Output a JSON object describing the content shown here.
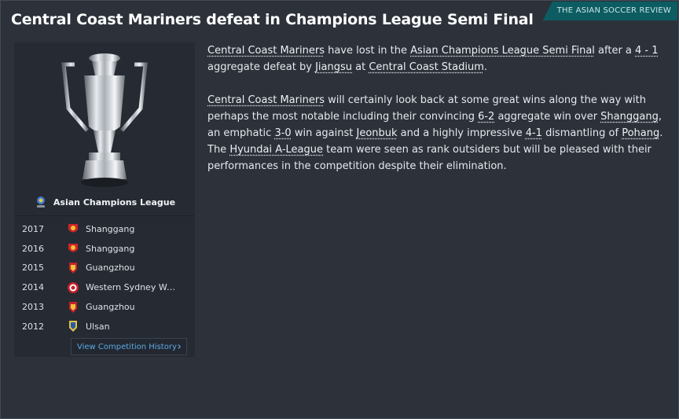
{
  "headline": "Central Coast Mariners defeat in Champions League Semi Final",
  "source": "THE ASIAN SOCCER REVIEW",
  "competition": {
    "name": "Asian Champions League",
    "history": [
      {
        "year": "2017",
        "team": "Shanggang"
      },
      {
        "year": "2016",
        "team": "Shanggang"
      },
      {
        "year": "2015",
        "team": "Guangzhou"
      },
      {
        "year": "2014",
        "team": "Western Sydney Wa..."
      },
      {
        "year": "2013",
        "team": "Guangzhou"
      },
      {
        "year": "2012",
        "team": "Ulsan"
      }
    ],
    "history_button": "View Competition History"
  },
  "article": {
    "p1": {
      "team": "Central Coast Mariners",
      "t1": " have lost in the ",
      "competition": "Asian Champions League Semi Final",
      "t2": " after a ",
      "score": "4 - 1",
      "t3": " aggregate defeat by ",
      "opponent": "Jiangsu",
      "t4": " at ",
      "stadium": "Central Coast Stadium",
      "t5": "."
    },
    "p2": {
      "team": "Central Coast Mariners",
      "t1": " will certainly look back at some great wins along the way with perhaps the most notable including their convincing ",
      "score1": "6-2",
      "t2": " aggregate win over ",
      "opp1": "Shanggang",
      "t3": ", an emphatic ",
      "score2": "3-0",
      "t4": " win against ",
      "opp2": "Jeonbuk",
      "t5": " and a highly impressive ",
      "score3": "4-1",
      "t6": " dismantling of ",
      "opp3": "Pohang",
      "t7": ". The ",
      "league": "Hyundai A-League",
      "t8": " team were seen as rank outsiders but will be pleased with their performances in the competition despite their elimination."
    }
  }
}
